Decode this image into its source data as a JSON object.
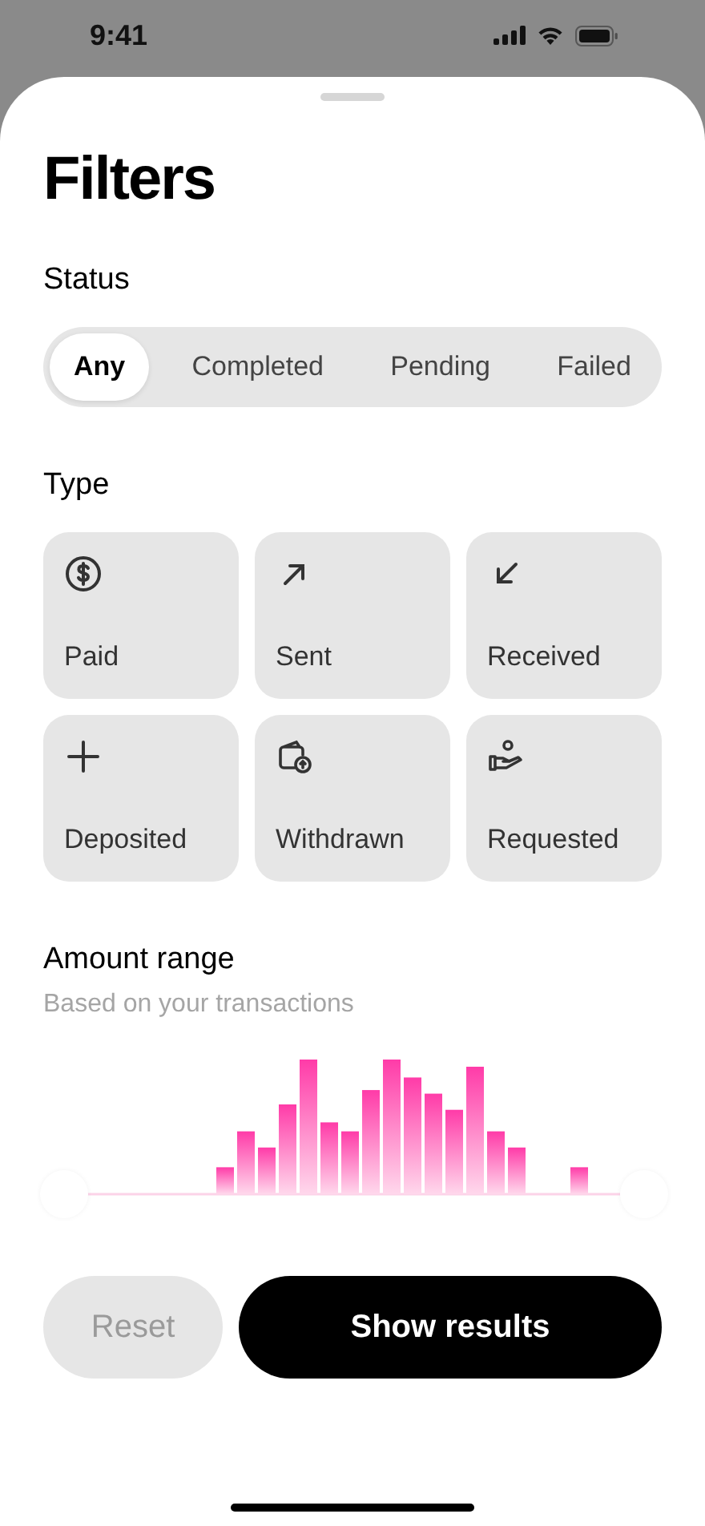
{
  "status_bar": {
    "time": "9:41"
  },
  "title": "Filters",
  "status": {
    "label": "Status",
    "options": [
      {
        "label": "Any",
        "selected": true
      },
      {
        "label": "Completed",
        "selected": false
      },
      {
        "label": "Pending",
        "selected": false
      },
      {
        "label": "Failed",
        "selected": false
      }
    ]
  },
  "type": {
    "label": "Type",
    "options": [
      {
        "label": "Paid",
        "kind": "dollar",
        "selected": false
      },
      {
        "label": "Sent",
        "kind": "up-right",
        "selected": false
      },
      {
        "label": "Received",
        "kind": "down-left",
        "selected": false
      },
      {
        "label": "Deposited",
        "kind": "plus",
        "selected": false
      },
      {
        "label": "Withdrawn",
        "kind": "wallet",
        "selected": false
      },
      {
        "label": "Requested",
        "kind": "hand",
        "selected": false
      }
    ]
  },
  "amount": {
    "label": "Amount range",
    "subtitle": "Based on your transactions"
  },
  "buttons": [
    {
      "label": "Reset",
      "kind": "secondary",
      "disabled": true
    },
    {
      "label": "Show results",
      "kind": "primary",
      "disabled": false
    }
  ]
}
